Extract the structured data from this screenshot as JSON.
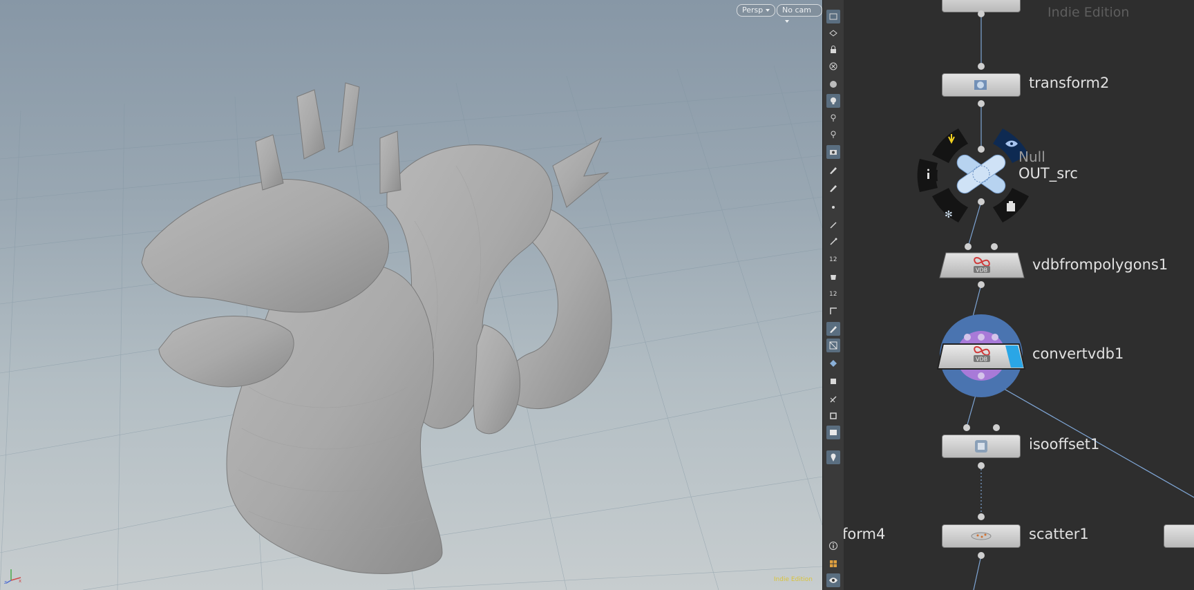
{
  "viewport": {
    "camera_menu": "Persp",
    "cam_menu": "No cam",
    "watermark": "Indie Edition"
  },
  "network": {
    "watermark": "Indie Edition",
    "nodes": [
      {
        "name": "transform2"
      },
      {
        "name": "OUT_src",
        "type": "Null"
      },
      {
        "name": "vdbfrompolygons1"
      },
      {
        "name": "convertvdb1"
      },
      {
        "name": "isooffset1"
      },
      {
        "name": "scatter1"
      },
      {
        "name": "form4"
      }
    ]
  },
  "colors": {
    "viewport_top": "#8797a6",
    "viewport_bottom": "#c7cdcf",
    "network_bg": "#2e2e2e",
    "selection_ring": "#4a74b0",
    "wire": "#7fa6d6",
    "watermark_yellow": "#d9c43a"
  }
}
